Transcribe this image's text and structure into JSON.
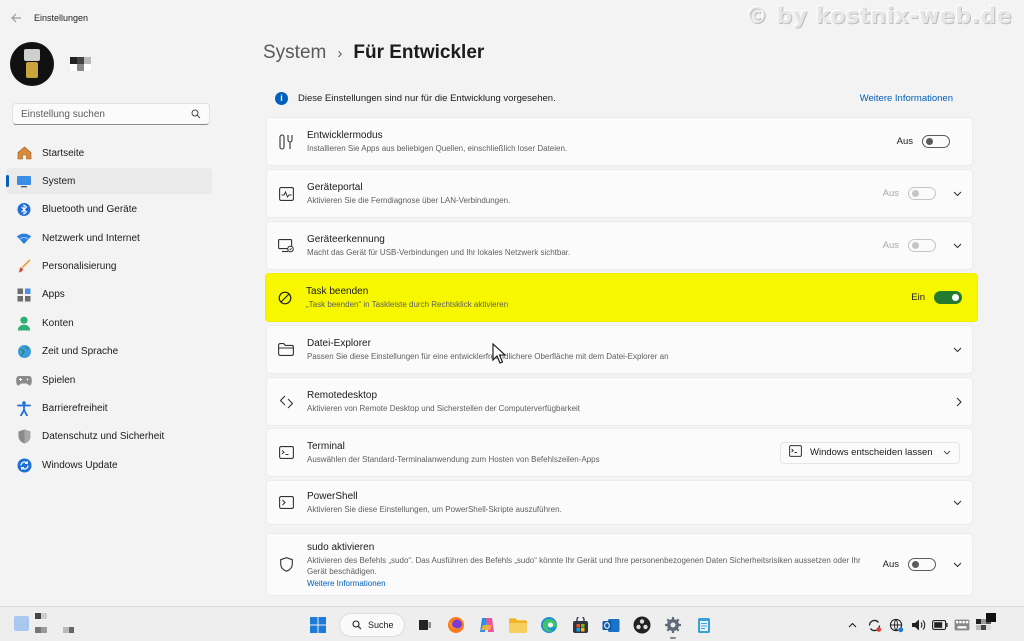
{
  "window": {
    "title": "Einstellungen",
    "watermark": "© by kostnix-web.de"
  },
  "search": {
    "placeholder": "Einstellung suchen"
  },
  "sidebar": {
    "items": [
      {
        "label": "Startseite",
        "icon": "home-icon"
      },
      {
        "label": "System",
        "icon": "monitor-icon",
        "active": true
      },
      {
        "label": "Bluetooth und Geräte",
        "icon": "bluetooth-icon"
      },
      {
        "label": "Netzwerk und Internet",
        "icon": "wifi-icon"
      },
      {
        "label": "Personalisierung",
        "icon": "brush-icon"
      },
      {
        "label": "Apps",
        "icon": "apps-icon"
      },
      {
        "label": "Konten",
        "icon": "account-icon"
      },
      {
        "label": "Zeit und Sprache",
        "icon": "globe-icon"
      },
      {
        "label": "Spielen",
        "icon": "gamepad-icon"
      },
      {
        "label": "Barrierefreiheit",
        "icon": "accessibility-icon"
      },
      {
        "label": "Datenschutz und Sicherheit",
        "icon": "shield-icon"
      },
      {
        "label": "Windows Update",
        "icon": "update-icon"
      }
    ]
  },
  "header": {
    "parent": "System",
    "separator": "›",
    "current": "Für Entwickler"
  },
  "info": {
    "text": "Diese Einstellungen sind nur für die Entwicklung vorgesehen.",
    "link": "Weitere Informationen"
  },
  "cards": [
    {
      "title": "Entwicklermodus",
      "desc": "Installieren Sie Apps aus beliebigen Quellen, einschließlich loser Dateien.",
      "toggle": "Aus"
    },
    {
      "title": "Geräteportal",
      "desc": "Aktivieren Sie die Ferndiagnose über LAN-Verbindungen.",
      "toggle": "Aus"
    },
    {
      "title": "Geräteerkennung",
      "desc": "Macht das Gerät für USB-Verbindungen und Ihr lokales Netzwerk sichtbar.",
      "toggle": "Aus"
    },
    {
      "title": "Task beenden",
      "desc": "„Task beenden“ in Taskleiste durch Rechtsklick aktivieren",
      "toggle": "Ein"
    },
    {
      "title": "Datei-Explorer",
      "desc": "Passen Sie diese Einstellungen für eine entwicklerfreundlichere Oberfläche mit dem Datei-Explorer an"
    },
    {
      "title": "Remotedesktop",
      "desc": "Aktivieren von Remote Desktop und Sicherstellen der Computerverfügbarkeit"
    },
    {
      "title": "Terminal",
      "desc": "Auswählen der Standard-Terminalanwendung zum Hosten von Befehlszeilen-Apps",
      "dropdown": "Windows entscheiden lassen"
    },
    {
      "title": "PowerShell",
      "desc": "Aktivieren Sie diese Einstellungen, um PowerShell-Skripte auszuführen."
    },
    {
      "title": "sudo aktivieren",
      "desc": "Aktivieren des Befehls „sudo“. Das Ausführen des Befehls „sudo“ könnte Ihr Gerät und Ihre personenbezogenen Daten Sicherheitsrisiken aussetzen oder Ihr Gerät beschädigen.",
      "link": "Weitere Informationen",
      "toggle": "Aus"
    }
  ],
  "taskbar": {
    "search_label": "Suche"
  },
  "colors": {
    "accent": "#005fb8",
    "toggle_on": "#247a2e",
    "highlight": "#f7f700"
  }
}
